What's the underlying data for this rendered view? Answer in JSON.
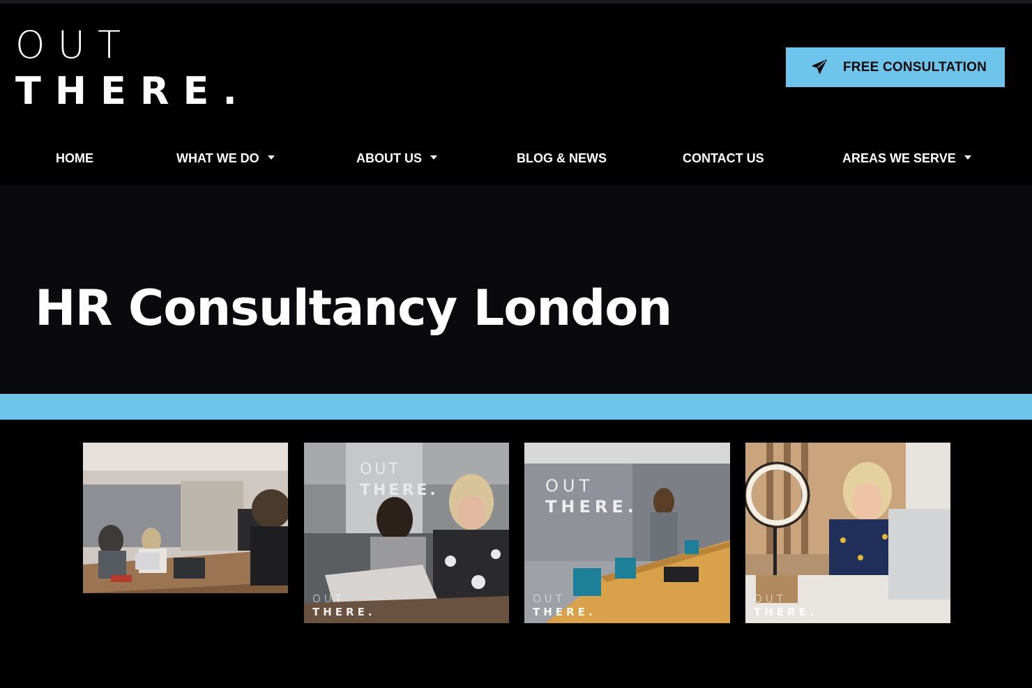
{
  "brand": {
    "logo_line1": "OUT",
    "logo_line2": "THERE.",
    "accent": "#6ec4ea",
    "background": "#000000",
    "hero_background": "#0a0a0d"
  },
  "header": {
    "cta_label": "FREE CONSULTATION",
    "cta_icon": "paper-plane-icon"
  },
  "nav": {
    "items": [
      {
        "label": "HOME",
        "has_dropdown": false
      },
      {
        "label": "WHAT WE DO",
        "has_dropdown": true
      },
      {
        "label": "ABOUT US",
        "has_dropdown": true
      },
      {
        "label": "BLOG & NEWS",
        "has_dropdown": false
      },
      {
        "label": "CONTACT US",
        "has_dropdown": false
      },
      {
        "label": "AREAS WE SERVE",
        "has_dropdown": true
      }
    ]
  },
  "hero": {
    "title": "HR Consultancy London"
  },
  "gallery": {
    "photos": [
      {
        "watermark_line1": "",
        "watermark_line2": ""
      },
      {
        "watermark_line1": "OUT",
        "watermark_line2": "THERE."
      },
      {
        "watermark_line1": "OUT",
        "watermark_line2": "THERE."
      },
      {
        "watermark_line1": "OUT",
        "watermark_line2": "THERE."
      }
    ]
  }
}
